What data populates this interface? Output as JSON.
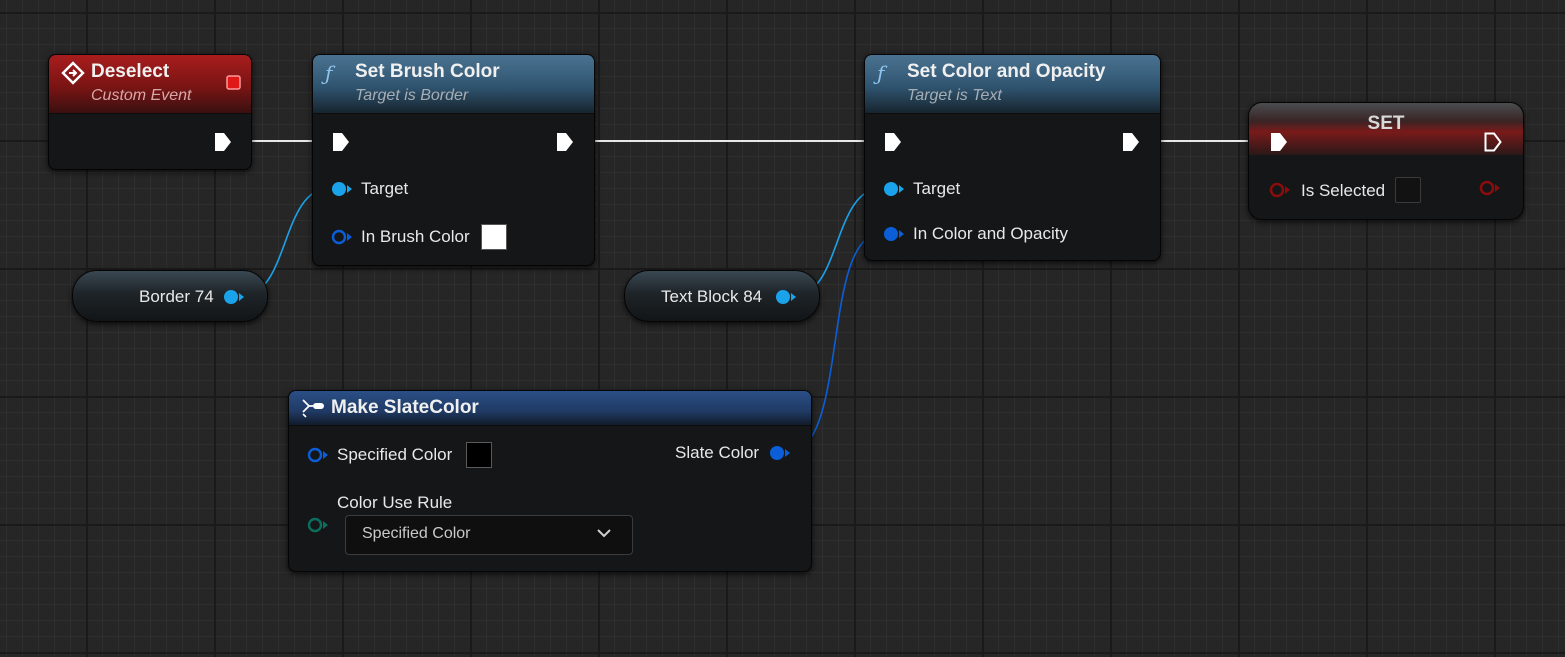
{
  "nodes": {
    "deselect": {
      "title": "Deselect",
      "subtitle": "Custom Event"
    },
    "set_brush_color": {
      "title": "Set Brush Color",
      "subtitle": "Target is Border",
      "pins": {
        "target": "Target",
        "in_brush_color": "In Brush Color"
      },
      "in_brush_color_value": "#ffffff"
    },
    "set_color_opacity": {
      "title": "Set Color and Opacity",
      "subtitle": "Target is Text",
      "pins": {
        "target": "Target",
        "in_color_and_opacity": "In Color and Opacity"
      }
    },
    "set": {
      "title": "SET",
      "pins": {
        "is_selected": "Is Selected"
      },
      "is_selected_value": false
    },
    "border_var": {
      "label": "Border 74"
    },
    "text_block_var": {
      "label": "Text Block 84"
    },
    "make_slate_color": {
      "title": "Make SlateColor",
      "pins": {
        "specified_color": "Specified Color",
        "color_use_rule": "Color Use Rule",
        "slate_color": "Slate Color"
      },
      "specified_color_value": "#000000",
      "color_use_rule_selected": "Specified Color"
    }
  },
  "colors": {
    "exec_pin": "#ffffff",
    "object_pin": "#1aa3ea",
    "struct_pin": "#0b5ed7",
    "bool_pin": "#8a0d0d",
    "enum_pin": "#0b6e5d",
    "event_header": "#a81d1d",
    "function_header": "#4a7391",
    "make_header": "#2b4f86"
  },
  "icons": {
    "event": "event-diamond-icon",
    "function": "function-f-icon",
    "make": "make-struct-icon",
    "dropdown": "chevron-down-icon"
  }
}
